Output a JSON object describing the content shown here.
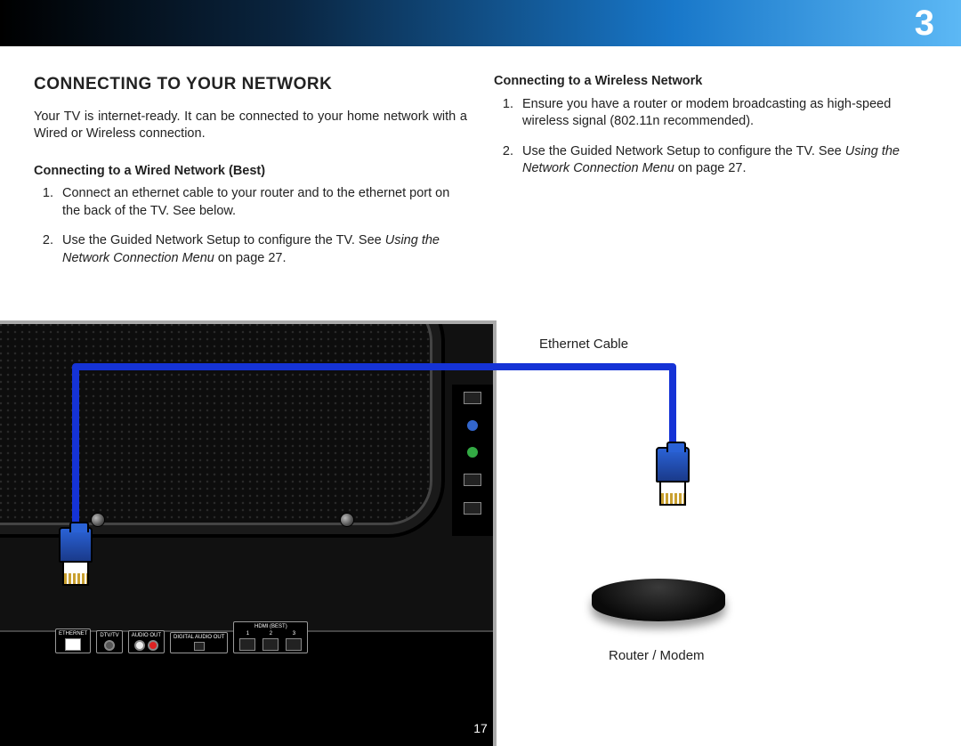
{
  "header": {
    "chapter": "3"
  },
  "page_number": "17",
  "left": {
    "title": "CONNECTING TO YOUR NETWORK",
    "intro": "Your TV is internet-ready. It can be connected to your home network with a Wired or Wireless connection.",
    "wired_heading": "Connecting to a Wired Network (Best)",
    "wired_steps": [
      "Connect an ethernet cable to your router and to the ethernet port on the back of the TV. See below.",
      {
        "pre": "Use the Guided Network Setup to configure the TV. See ",
        "ref": "Using the Network Connection Menu",
        "post": " on page 27."
      }
    ]
  },
  "right": {
    "wireless_heading": "Connecting to a Wireless Network",
    "wireless_steps": [
      "Ensure you have a router or modem broadcasting as high-speed wireless signal (802.11n recommended).",
      {
        "pre": "Use the Guided Network Setup to configure the TV. See ",
        "ref": "Using the Network Connection Menu",
        "post": " on page 27."
      }
    ]
  },
  "diagram": {
    "ethernet_label": "Ethernet Cable",
    "router_label": "Router / Modem",
    "ports": {
      "ethernet": "ETHERNET",
      "dtv": "DTV/TV",
      "audio_out": "AUDIO OUT",
      "digital_audio": "DIGITAL AUDIO OUT",
      "hdmi": "HDMI (BEST)",
      "hdmi1": "1",
      "hdmi2": "2",
      "hdmi3": "3"
    }
  }
}
